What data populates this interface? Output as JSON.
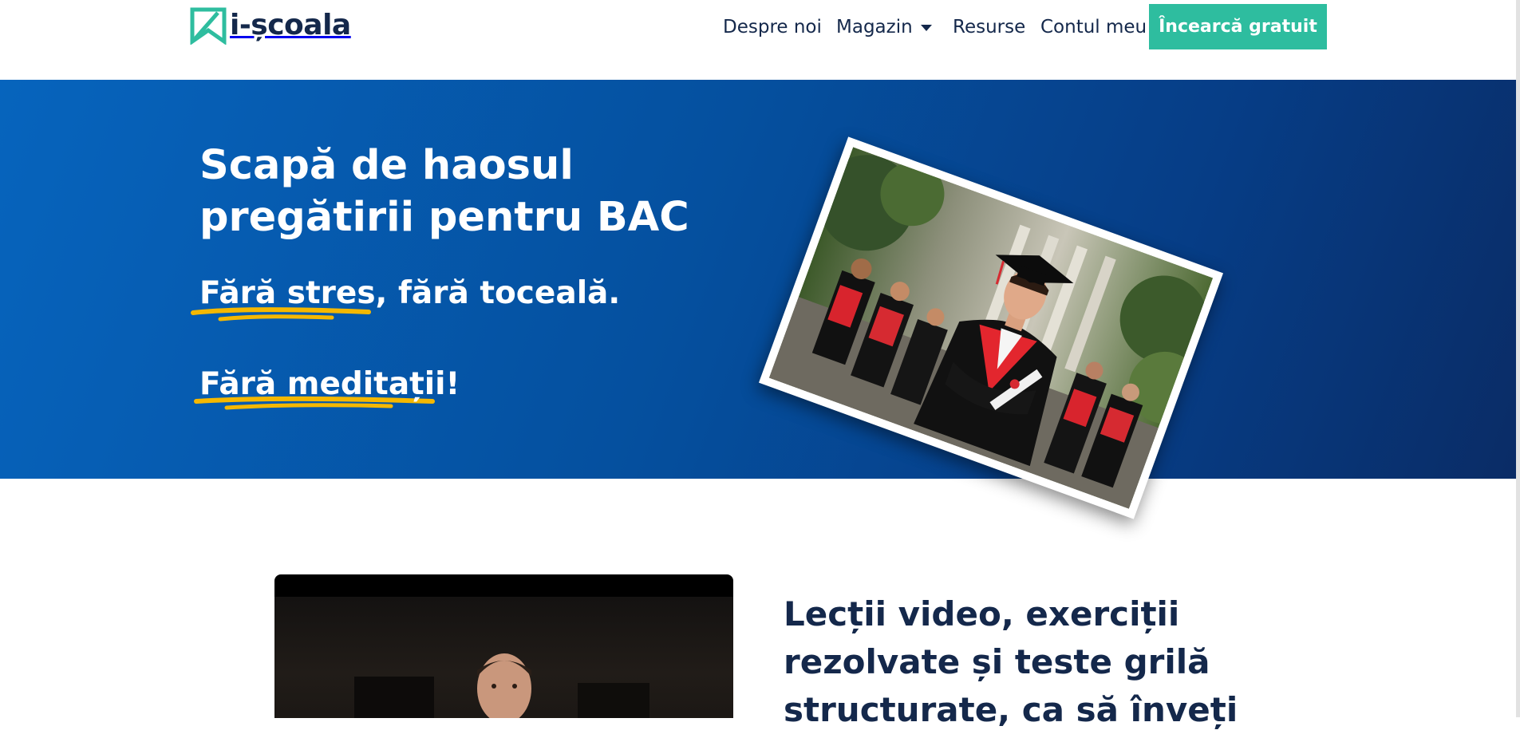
{
  "header": {
    "logo_text": "i-școala",
    "nav": {
      "despre": "Despre noi",
      "magazin": "Magazin",
      "resurse": "Resurse",
      "contul": "Contul meu"
    },
    "cta_label": "Încearcă gratuit"
  },
  "hero": {
    "title_line1": "Scapă de haosul",
    "title_line2": "pregătirii pentru BAC",
    "subtitle_highlight": "Fără stres,",
    "subtitle_rest": " fără toceală.",
    "subtitle2": "Fără meditații!"
  },
  "section": {
    "title_line1": "Lecții video, exerciții",
    "title_line2": "rezolvate și teste grilă",
    "title_line3": "structurate, ca să înveți"
  },
  "colors": {
    "brand_navy": "#14284b",
    "accent_green": "#2ebd9f",
    "hero_blue": "#05509f",
    "highlight_yellow": "#f5b800"
  },
  "icons": {
    "logo": "bookmark-logo-icon",
    "dropdown": "caret-down-icon"
  }
}
